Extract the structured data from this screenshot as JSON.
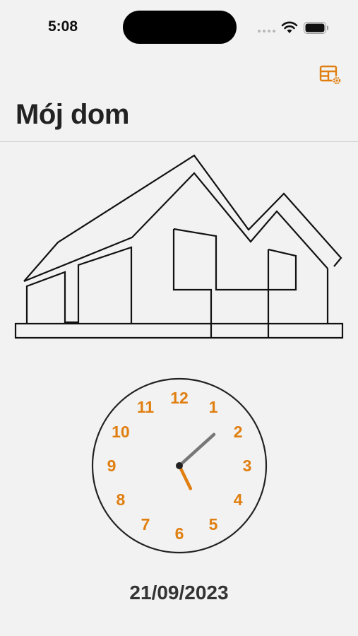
{
  "status_bar": {
    "time": "5:08",
    "icons": [
      "wifi-icon",
      "battery-icon"
    ]
  },
  "toolbar": {
    "settings_icon": "grid-gear-icon"
  },
  "header": {
    "title": "Mój dom"
  },
  "clock": {
    "numbers": [
      "12",
      "1",
      "2",
      "3",
      "4",
      "5",
      "6",
      "7",
      "8",
      "9",
      "10",
      "11"
    ],
    "hour": 5,
    "minute": 8
  },
  "footer": {
    "date": "21/09/2023"
  },
  "colors": {
    "accent": "#e07f10",
    "background": "#f2f2f2",
    "text": "#222222",
    "minute_hand": "#777777"
  }
}
